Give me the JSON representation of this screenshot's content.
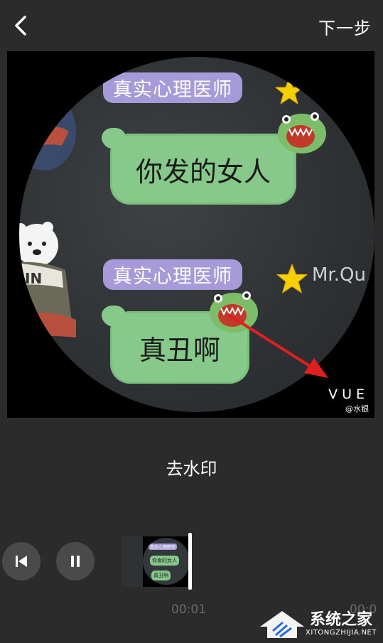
{
  "topbar": {
    "back_icon": "chevron-left-icon",
    "next_label": "下一步"
  },
  "preview": {
    "pill_top": "真实心理医师",
    "bubble_top": "你发的女人",
    "pill_bottom": "真实心理医师",
    "mr_text": "Mr.Qu",
    "bubble_bottom": "真丑啊",
    "watermark_main": "VUE",
    "watermark_sub": "@水银",
    "sticker_text": "IN"
  },
  "action": {
    "remove_watermark_label": "去水印"
  },
  "player": {
    "prev_icon": "skip-previous-icon",
    "pause_icon": "pause-icon",
    "time_current": "00:01",
    "time_next": "00:0"
  },
  "thumbnail": {
    "pill": "真实心理医师",
    "bubble": "你发的女人",
    "bubble2": "真丑啊"
  },
  "site": {
    "name": "系统之家",
    "url": "XITONGZHIJIA.NET"
  },
  "colors": {
    "background": "#2b2b2b",
    "pill": "#a69bd8",
    "bubble": "#87c98a",
    "arrow": "#e02020",
    "star": "#f5d000"
  }
}
